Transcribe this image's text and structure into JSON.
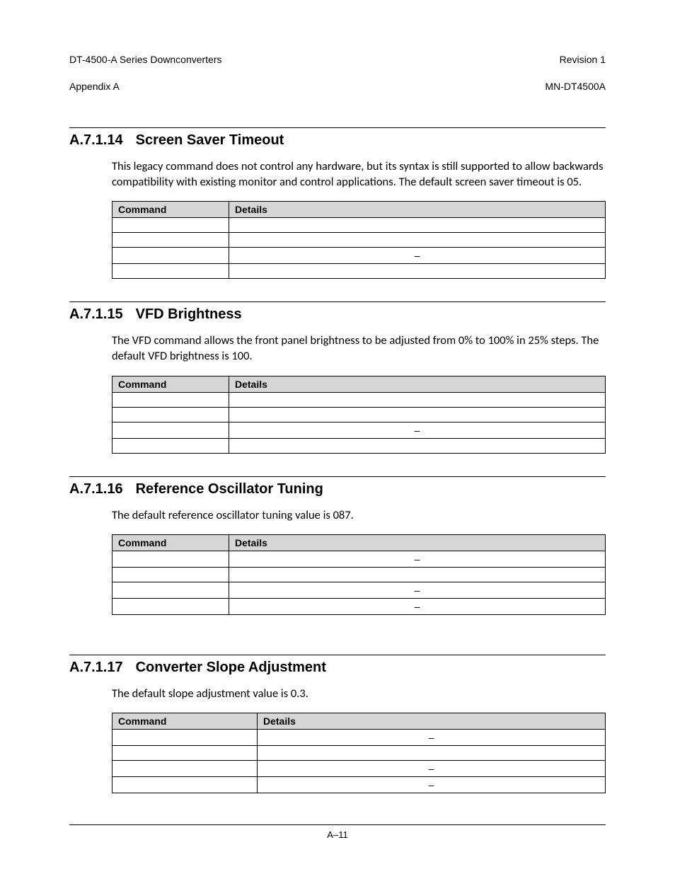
{
  "header": {
    "left_line1": "DT-4500-A Series Downconverters",
    "left_line2": "Appendix A",
    "right_line1": "Revision 1",
    "right_line2": "MN-DT4500A"
  },
  "sections": [
    {
      "num": "A.7.1.14",
      "title": "Screen Saver Timeout",
      "body": "This legacy command does not control any hardware, but its syntax is still supported to allow backwards compatibility with existing monitor and control applications. The default screen saver timeout is 05.",
      "table_variant": "",
      "headers": [
        "Command",
        "Details"
      ],
      "rows": [
        [
          "",
          ""
        ],
        [
          "",
          ""
        ],
        [
          "",
          "–"
        ],
        [
          "",
          ""
        ]
      ]
    },
    {
      "num": "A.7.1.15",
      "title": "VFD Brightness",
      "body": "The VFD command allows the front panel brightness to be adjusted from 0% to 100% in 25% steps. The default VFD brightness is 100.",
      "table_variant": "",
      "headers": [
        "Command",
        "Details"
      ],
      "rows": [
        [
          "",
          ""
        ],
        [
          "",
          ""
        ],
        [
          "",
          "–"
        ],
        [
          "",
          ""
        ]
      ]
    },
    {
      "num": "A.7.1.16",
      "title": "Reference Oscillator Tuning",
      "body": "The default reference oscillator tuning value is 087.",
      "table_variant": "",
      "headers": [
        "Command",
        "Details"
      ],
      "rows": [
        [
          "",
          "–"
        ],
        [
          "",
          ""
        ],
        [
          "",
          "–"
        ],
        [
          "",
          "–"
        ]
      ]
    },
    {
      "num": "A.7.1.17",
      "title": "Converter Slope Adjustment",
      "body": "The default slope adjustment value is 0.3.",
      "table_variant": "w4",
      "headers": [
        "Command",
        "Details"
      ],
      "rows": [
        [
          "",
          "–"
        ],
        [
          "",
          ""
        ],
        [
          "",
          "–"
        ],
        [
          "",
          "–"
        ]
      ]
    }
  ],
  "footer": {
    "page": "A–11"
  }
}
